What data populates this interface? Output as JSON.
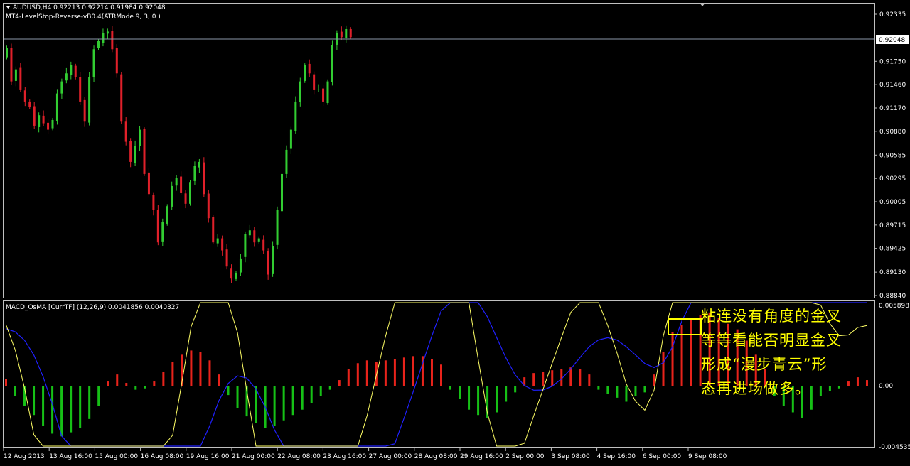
{
  "main_chart": {
    "symbol_info": "AUDUSD,H4  0.92213 0.92214 0.91984 0.92048",
    "indicator_name": "MT4-LevelStop-Reverse-vB0.4(ATRMode 9, 3, 0 )",
    "current_price_label": "0.92048",
    "price_ticks": [
      "0.92335",
      "0.92048",
      "0.91750",
      "0.91460",
      "0.91170",
      "0.90880",
      "0.90585",
      "0.90295",
      "0.90005",
      "0.89715",
      "0.89425",
      "0.89130",
      "0.88840"
    ]
  },
  "sub_chart": {
    "indicator_name": "MACD_OsMA [CurrTF] (12,26,9) 0.0041856 0.0040327",
    "value_ticks": [
      "0.005898",
      "0.00",
      "-0.004535"
    ]
  },
  "time_axis": {
    "labels": [
      "12 Aug 2013",
      "13 Aug 16:00",
      "15 Aug 00:00",
      "16 Aug 08:00",
      "19 Aug 16:00",
      "21 Aug 00:00",
      "22 Aug 08:00",
      "23 Aug 16:00",
      "27 Aug 00:00",
      "28 Aug 08:00",
      "29 Aug 16:00",
      "2 Sep 00:00",
      "3 Sep 08:00",
      "4 Sep 16:00",
      "6 Sep 00:00",
      "9 Sep 08:00"
    ]
  },
  "annotation": {
    "lines": [
      "粘连没有角度的金叉",
      "等等看能否明显金叉",
      "形成“漫步青云”形",
      "态再进场做多。"
    ]
  },
  "colors": {
    "background": "#000000",
    "bull_candle": "#32cd32",
    "bear_candle": "#e0202a",
    "hist_negative": "#16c016",
    "hist_positive": "#e8231b",
    "macd_line": "#ffff66",
    "signal_line": "#2020ff",
    "annotation": "#ffff00",
    "axis": "#c0c0c0"
  },
  "chart_data": [
    {
      "type": "candlestick",
      "symbol": "AUDUSD",
      "timeframe": "H4",
      "close_series": [
        0.9192,
        0.915,
        0.9165,
        0.914,
        0.9125,
        0.9118,
        0.9095,
        0.9108,
        0.9098,
        0.909,
        0.9102,
        0.9135,
        0.915,
        0.916,
        0.917,
        0.9155,
        0.9125,
        0.91,
        0.9155,
        0.919,
        0.92,
        0.921,
        0.9212,
        0.919,
        0.916,
        0.91,
        0.9075,
        0.905,
        0.907,
        0.909,
        0.9035,
        0.901,
        0.899,
        0.895,
        0.8975,
        0.8995,
        0.902,
        0.903,
        0.9012,
        0.8998,
        0.9025,
        0.9045,
        0.905,
        0.901,
        0.898,
        0.895,
        0.8955,
        0.894,
        0.892,
        0.8905,
        0.8912,
        0.893,
        0.896,
        0.8965,
        0.895,
        0.8955,
        0.894,
        0.891,
        0.8945,
        0.899,
        0.9035,
        0.9065,
        0.909,
        0.9125,
        0.915,
        0.917,
        0.916,
        0.914,
        0.914,
        0.9125,
        0.915,
        0.9195,
        0.921,
        0.9205,
        0.9215,
        0.9205
      ]
    },
    {
      "type": "bar",
      "name": "MACD_OsMA [CurrTF] (12,26,9)",
      "ylim": [
        -0.004535,
        0.005898
      ],
      "values": [
        0.0005,
        -0.0008,
        -0.0015,
        -0.0022,
        -0.003,
        -0.0036,
        -0.0038,
        -0.0035,
        -0.0032,
        -0.0025,
        -0.0015,
        0.0003,
        0.0008,
        0.0002,
        -0.0003,
        -0.0002,
        0.0003,
        0.001,
        0.0017,
        0.0022,
        0.0025,
        0.0024,
        0.0018,
        0.0008,
        -0.0007,
        -0.0017,
        -0.0023,
        -0.0028,
        -0.0032,
        -0.003,
        -0.0026,
        -0.0022,
        -0.0018,
        -0.0013,
        -0.0008,
        -0.0003,
        0.0004,
        0.0012,
        0.0016,
        0.0018,
        0.0017,
        0.0018,
        0.0019,
        0.002,
        0.0021,
        0.0021,
        0.0019,
        0.0015,
        -0.0003,
        -0.001,
        -0.0018,
        -0.0022,
        -0.0024,
        -0.002,
        -0.0012,
        -0.0005,
        0.0006,
        0.0009,
        0.001,
        0.0011,
        0.0012,
        0.0013,
        0.0012,
        0.0008,
        -0.0003,
        -0.0006,
        -0.0009,
        -0.0012,
        -0.0008,
        -0.0005,
        0.0008,
        0.0024,
        0.0038,
        0.0043,
        0.0047,
        0.005,
        0.0052,
        0.0048,
        0.0044,
        0.004,
        0.0032,
        0.0022,
        0.0012,
        -0.0008,
        -0.0015,
        -0.002,
        -0.0024,
        -0.0018,
        -0.0008,
        -0.0004,
        -0.0002,
        0.0003,
        0.0006,
        0.0004
      ]
    }
  ]
}
